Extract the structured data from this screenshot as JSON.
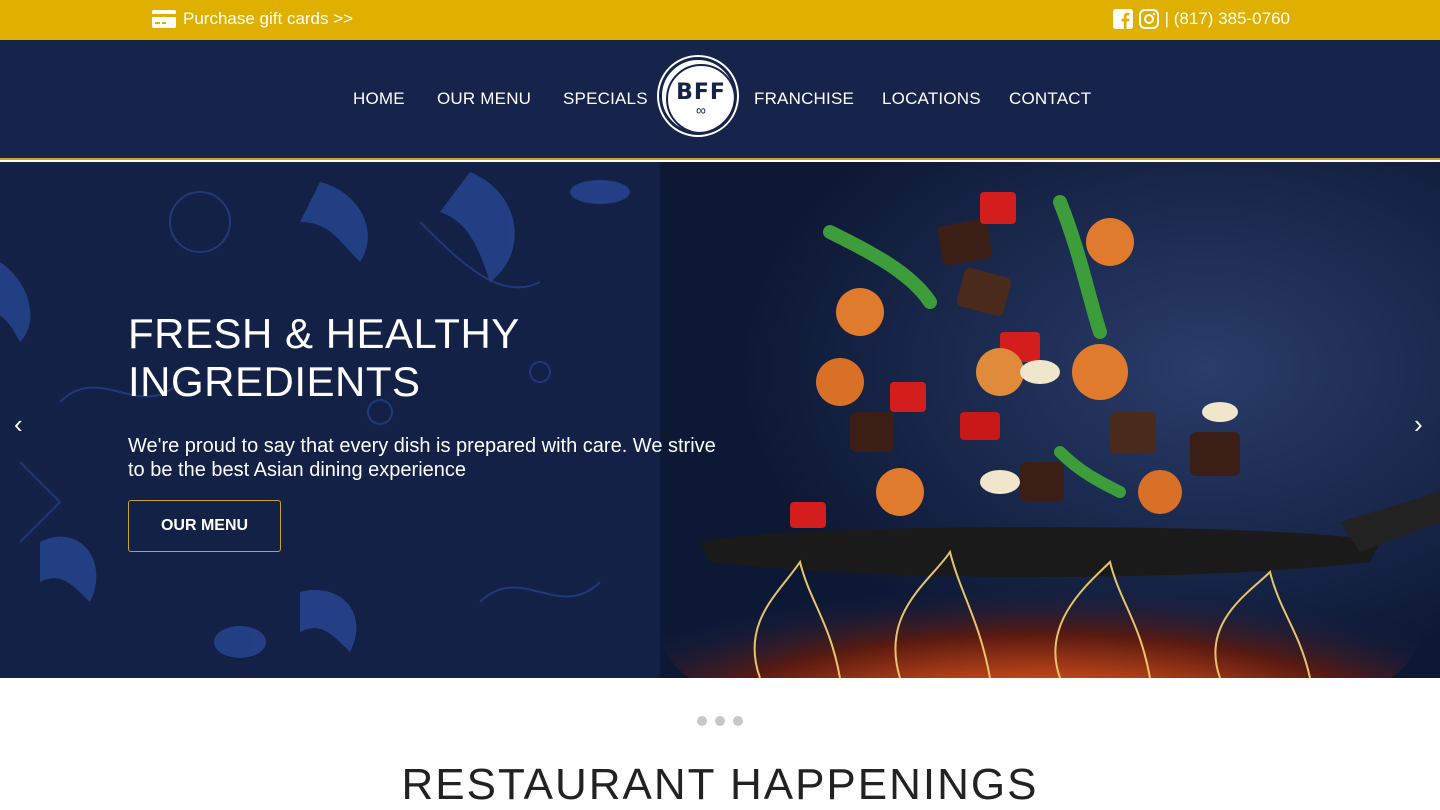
{
  "topbar": {
    "gift_label": "Purchase gift cards >>",
    "phone": "| (817) 385-0760",
    "icons": [
      "credit-card-icon",
      "facebook-icon",
      "instagram-icon"
    ]
  },
  "nav": {
    "items": [
      {
        "label": "HOME"
      },
      {
        "label": "OUR MENU"
      },
      {
        "label": "SPECIALS"
      },
      {
        "label": "FRANCHISE"
      },
      {
        "label": "LOCATIONS"
      },
      {
        "label": "CONTACT"
      }
    ],
    "logo": {
      "text": "BFF",
      "symbol": "∞"
    }
  },
  "hero": {
    "title_line1": "FRESH & HEALTHY",
    "title_line2": "INGREDIENTS",
    "text": "We're proud to say that every dish is prepared with care. We strive to be the best Asian dining experience",
    "button": "OUR MENU",
    "prev": "‹",
    "next": "›"
  },
  "carousel": {
    "slides": 3,
    "active": 1
  },
  "section": {
    "title": "RESTAURANT HAPPENINGS"
  },
  "colors": {
    "gold": "#e0b000",
    "navy": "#16234a",
    "border_gold": "#c9a227"
  }
}
